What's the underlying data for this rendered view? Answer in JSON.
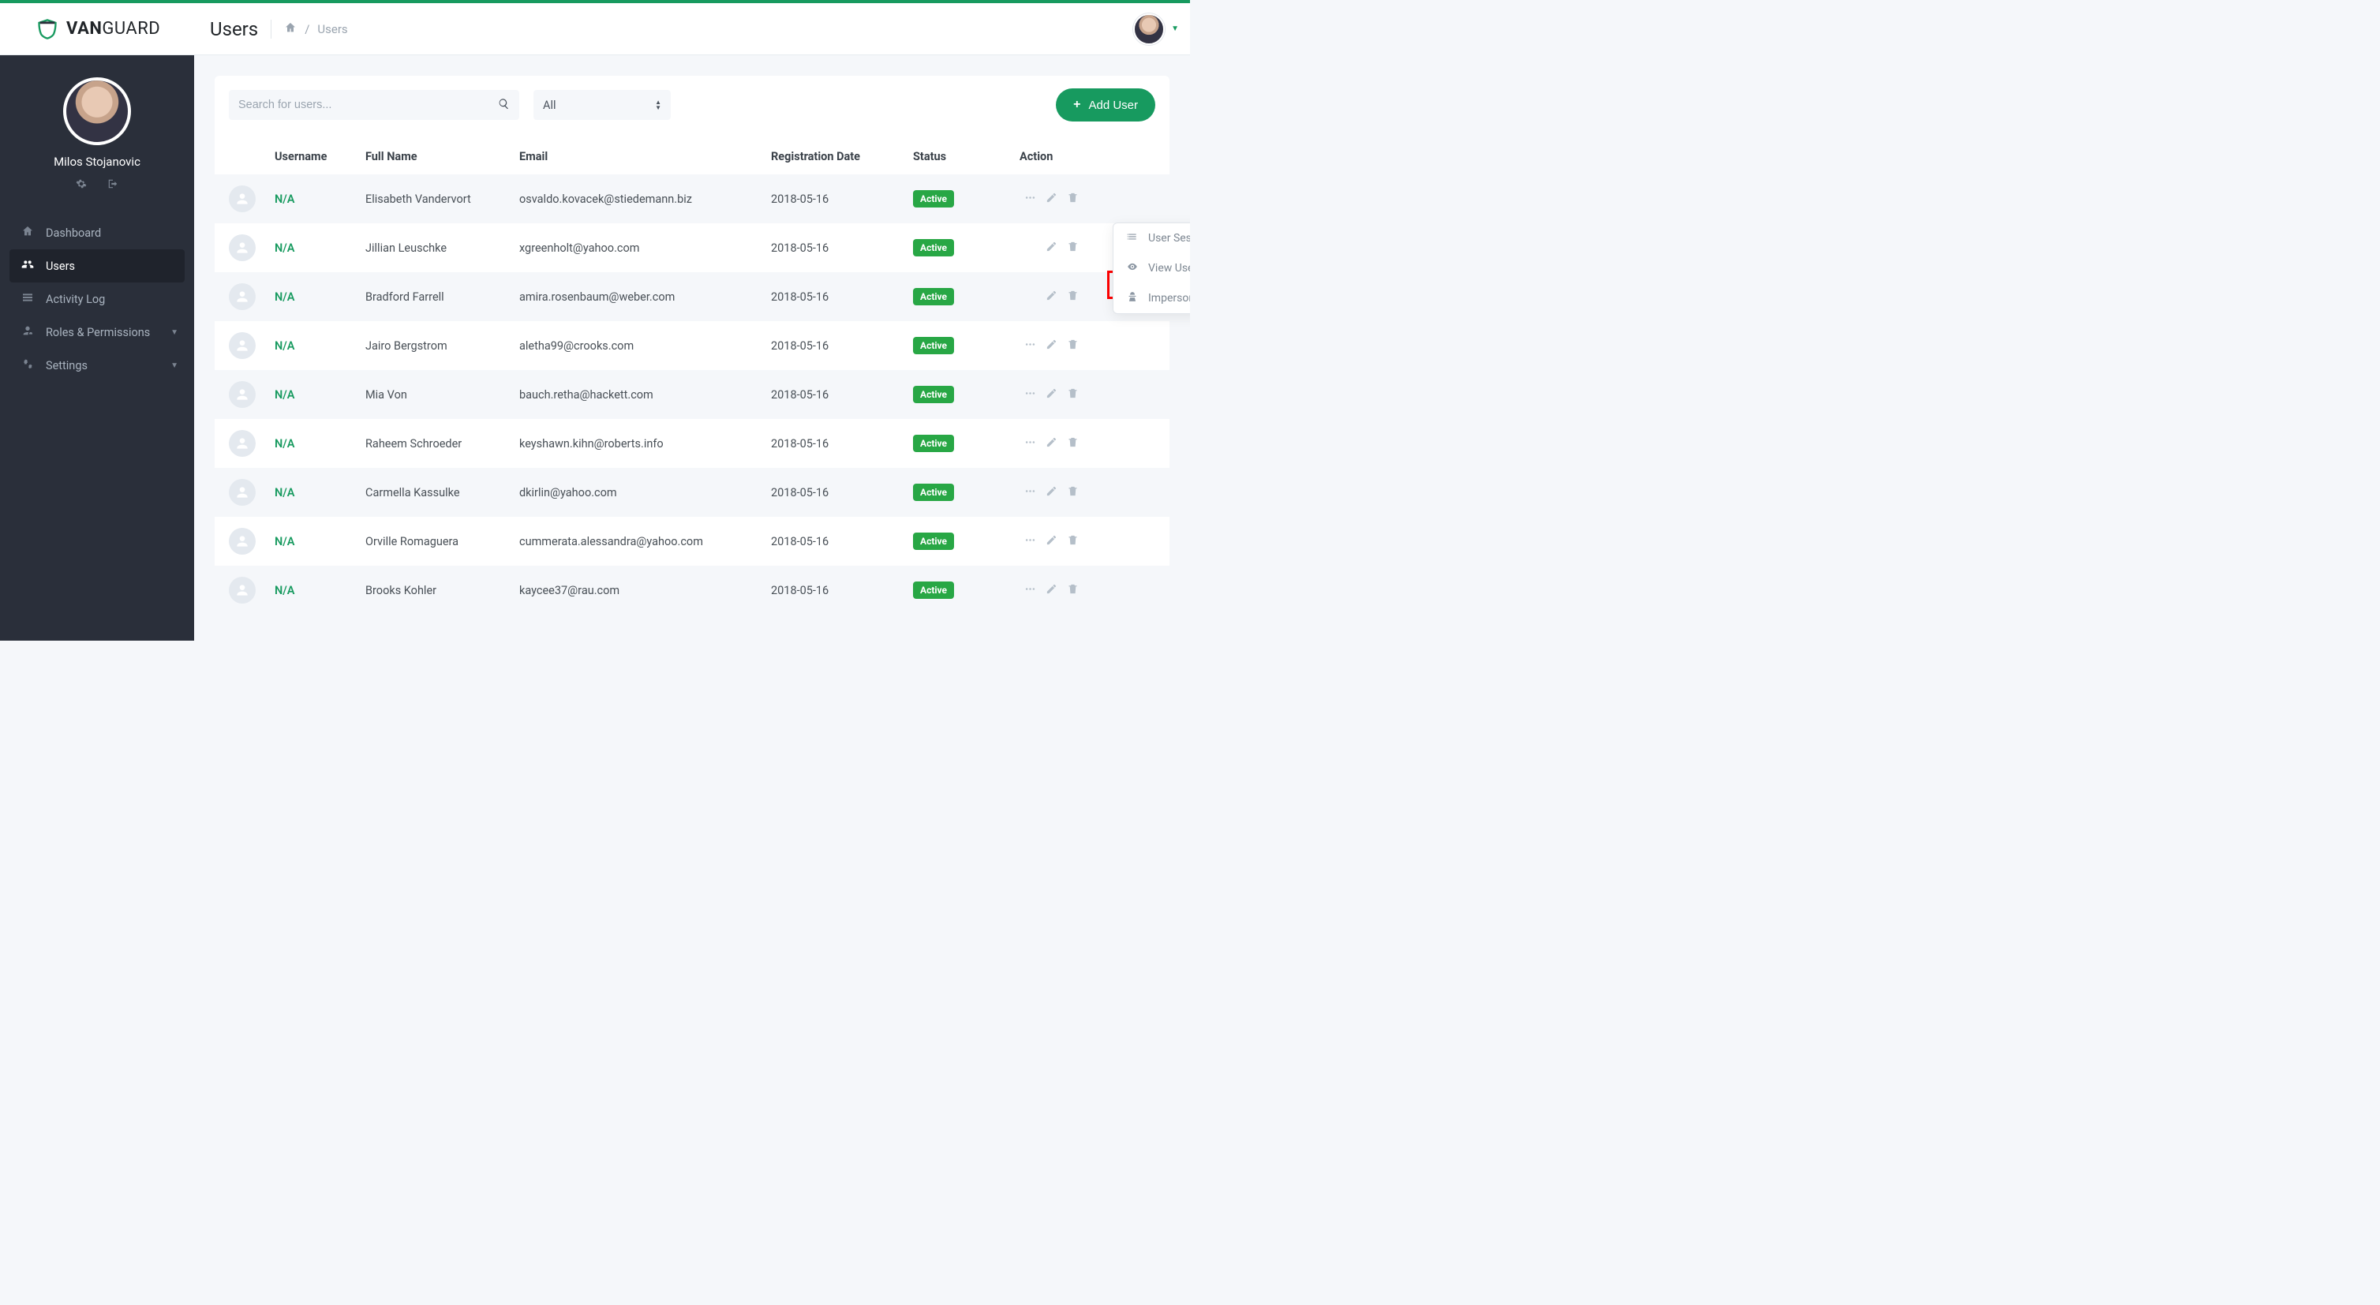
{
  "brand": {
    "prefix": "VAN",
    "suffix": "GUARD"
  },
  "page": {
    "title": "Users",
    "breadcrumb_current": "Users"
  },
  "profile": {
    "name": "Milos Stojanovic"
  },
  "nav": {
    "items": [
      {
        "label": "Dashboard",
        "icon": "home"
      },
      {
        "label": "Users",
        "icon": "users",
        "active": true
      },
      {
        "label": "Activity Log",
        "icon": "list"
      },
      {
        "label": "Roles & Permissions",
        "icon": "roles",
        "caret": true
      },
      {
        "label": "Settings",
        "icon": "gears",
        "caret": true
      }
    ]
  },
  "toolbar": {
    "search_placeholder": "Search for users...",
    "status_filter": "All",
    "add_label": "Add User"
  },
  "table": {
    "headers": {
      "username": "Username",
      "fullname": "Full Name",
      "email": "Email",
      "regdate": "Registration Date",
      "status": "Status",
      "action": "Action"
    },
    "rows": [
      {
        "username": "N/A",
        "fullname": "Elisabeth Vandervort",
        "email": "osvaldo.kovacek@stiedemann.biz",
        "regdate": "2018-05-16",
        "status": "Active"
      },
      {
        "username": "N/A",
        "fullname": "Jillian Leuschke",
        "email": "xgreenholt@yahoo.com",
        "regdate": "2018-05-16",
        "status": "Active"
      },
      {
        "username": "N/A",
        "fullname": "Bradford Farrell",
        "email": "amira.rosenbaum@weber.com",
        "regdate": "2018-05-16",
        "status": "Active"
      },
      {
        "username": "N/A",
        "fullname": "Jairo Bergstrom",
        "email": "aletha99@crooks.com",
        "regdate": "2018-05-16",
        "status": "Active"
      },
      {
        "username": "N/A",
        "fullname": "Mia Von",
        "email": "bauch.retha@hackett.com",
        "regdate": "2018-05-16",
        "status": "Active"
      },
      {
        "username": "N/A",
        "fullname": "Raheem Schroeder",
        "email": "keyshawn.kihn@roberts.info",
        "regdate": "2018-05-16",
        "status": "Active"
      },
      {
        "username": "N/A",
        "fullname": "Carmella Kassulke",
        "email": "dkirlin@yahoo.com",
        "regdate": "2018-05-16",
        "status": "Active"
      },
      {
        "username": "N/A",
        "fullname": "Orville Romaguera",
        "email": "cummerata.alessandra@yahoo.com",
        "regdate": "2018-05-16",
        "status": "Active"
      },
      {
        "username": "N/A",
        "fullname": "Brooks Kohler",
        "email": "kaycee37@rau.com",
        "regdate": "2018-05-16",
        "status": "Active"
      }
    ]
  },
  "dropdown": {
    "items": [
      {
        "label": "User Sessions",
        "icon": "list"
      },
      {
        "label": "View User",
        "icon": "eye"
      },
      {
        "label": "Impersonate",
        "icon": "secret"
      }
    ]
  }
}
